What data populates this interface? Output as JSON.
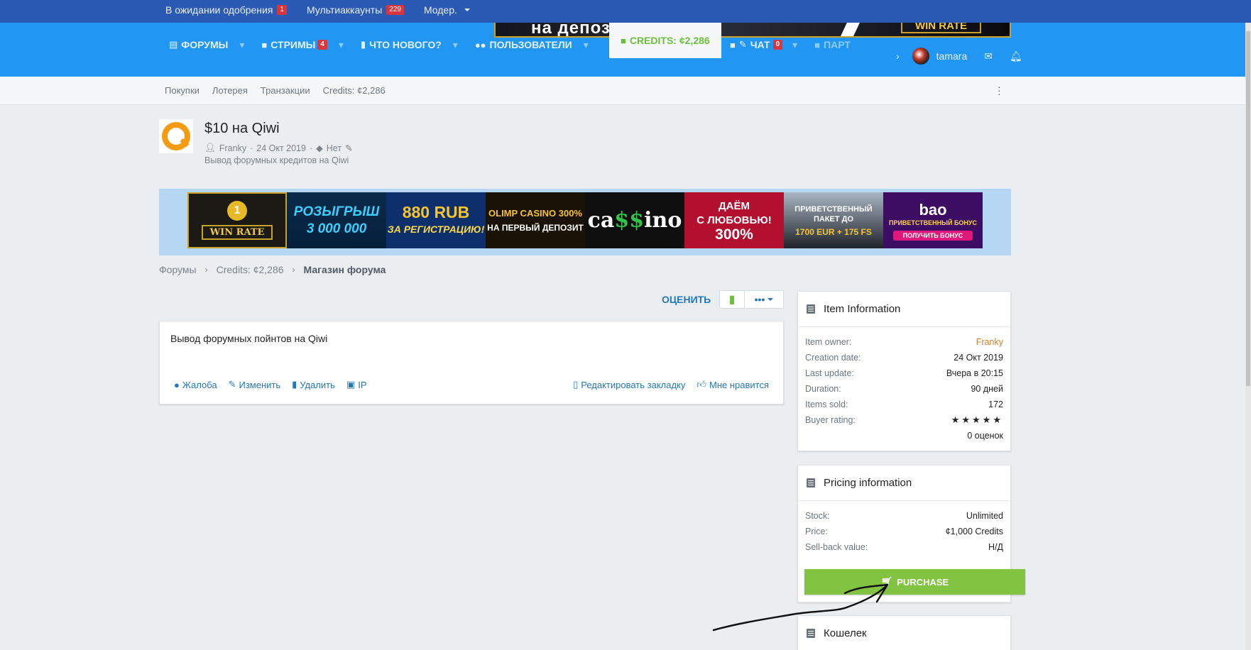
{
  "staffbar": {
    "pending_label": "В ожидании одобрения",
    "pending_count": "1",
    "multi_label": "Мультиаккаунты",
    "multi_count": "229",
    "moder_label": "Модер."
  },
  "top_banner": {
    "text_left": "на депозиты",
    "text_right": "WIN RATE"
  },
  "nav": {
    "forums": "ФОРУМЫ",
    "streams": "СТРИМЫ",
    "streams_badge": "4",
    "whats_new": "ЧТО НОВОГО?",
    "users": "ПОЛЬЗОВАТЕЛИ",
    "credits": "CREDITS: ¢2,286",
    "chat": "ЧАТ",
    "chat_badge": "0",
    "partners": "ПАРТ",
    "username": "tamara"
  },
  "subnav": {
    "items": [
      "Покупки",
      "Лотерея",
      "Транзакции",
      "Credits: ¢2,286"
    ]
  },
  "item": {
    "title": "$10 на Qiwi",
    "author": "Franky",
    "date": "24 Окт 2019",
    "tags": "Нет",
    "tagline": "Вывод форумных кредитов на Qiwi"
  },
  "ads": {
    "a1": "WIN RATE",
    "a1_medal": "1",
    "a2_l1": "РОЗЫГРЫШ",
    "a2_l2": "3 000 000",
    "a3_l1": "880 RUB",
    "a3_l2": "ЗА РЕГИСТРАЦИЮ!",
    "a4_l1": "OLIMP CASINO 300%",
    "a4_l2": "НА ПЕРВЫЙ ДЕПОЗИТ",
    "a5_l1": "ca",
    "a5_l2": "$$",
    "a5_l3": "ino",
    "a6_l1": "ДАЁМ",
    "a6_l2": "С ЛЮБОВЬЮ!",
    "a6_l3": "300%",
    "a7_l1": "ПРИВЕТСТВЕННЫЙ",
    "a7_l2": "ПАКЕТ ДО",
    "a7_l3": "1700 EUR + 175 FS",
    "a8_l1": "bao",
    "a8_l2": "ПРИВЕТСТВЕННЫЙ БОНУС",
    "a8_l3": "ПОЛУЧИТЬ БОНУС"
  },
  "breadcrumb": [
    "Форумы",
    "Credits: ¢2,286",
    "Магазин форума"
  ],
  "actions": {
    "rate": "ОЦЕНИТЬ",
    "more": "•••"
  },
  "post": {
    "body": "Вывод форумных пойнтов на Qiwi",
    "report": "Жалоба",
    "edit": "Изменить",
    "delete": "Удалить",
    "ip": "IP",
    "bookmark": "Редактировать закладку",
    "like": "Мне нравится"
  },
  "item_info": {
    "title": "Item Information",
    "rows": [
      {
        "k": "Item owner:",
        "v": "Franky"
      },
      {
        "k": "Creation date:",
        "v": "24 Окт 2019"
      },
      {
        "k": "Last update:",
        "v": "Вчера в 20:15"
      },
      {
        "k": "Duration:",
        "v": "90 дней"
      },
      {
        "k": "Items sold:",
        "v": "172"
      },
      {
        "k": "Buyer rating:",
        "v": "★★★★★"
      }
    ],
    "rating_count": "0 оценок"
  },
  "pricing": {
    "title": "Pricing information",
    "rows": [
      {
        "k": "Stock:",
        "v": "Unlimited"
      },
      {
        "k": "Price:",
        "v": "¢1,000 Credits"
      },
      {
        "k": "Sell-back value:",
        "v": "Н/Д"
      }
    ],
    "purchase": "PURCHASE"
  },
  "wallet": {
    "title": "Кошелек"
  },
  "colors": {
    "nav": "#2196f3",
    "staffbar": "#2b5ab4",
    "accent_green": "#82c341",
    "link": "#2577b8"
  }
}
